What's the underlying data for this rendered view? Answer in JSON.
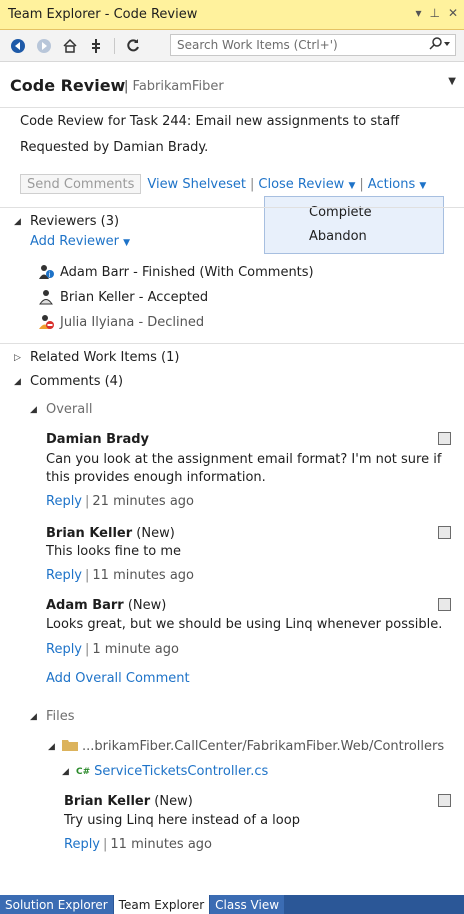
{
  "window": {
    "title": "Team Explorer - Code Review"
  },
  "toolbar": {
    "search_placeholder": "Search Work Items (Ctrl+')"
  },
  "header": {
    "title": "Code Review",
    "project": "FabrikamFiber"
  },
  "review": {
    "title_line": "Code Review for Task 244: Email new assignments to staff",
    "requested_line": "Requested by Damian Brady."
  },
  "actions": {
    "send_comments": "Send Comments",
    "view_shelveset": "View Shelveset",
    "close_review": "Close Review",
    "actions": "Actions"
  },
  "close_menu": {
    "complete": "Complete",
    "abandon": "Abandon"
  },
  "reviewers": {
    "header": "Reviewers (3)",
    "add": "Add Reviewer",
    "items": [
      {
        "text": "Adam Barr - Finished (With Comments)",
        "icon": "reviewer-finished-icon"
      },
      {
        "text": "Brian Keller - Accepted",
        "icon": "reviewer-accepted-icon"
      },
      {
        "text": "Julia Ilyiana - Declined",
        "icon": "reviewer-declined-icon"
      }
    ]
  },
  "related": {
    "header": "Related Work Items (1)"
  },
  "comments": {
    "header": "Comments (4)",
    "overall_label": "Overall",
    "add_overall": "Add Overall Comment",
    "overall": [
      {
        "author": "Damian Brady",
        "status": "",
        "text1": "Can you look at the assignment email format? I'm not sure if",
        "text2": "this provides enough information.",
        "reply": "Reply",
        "time": "21 minutes ago"
      },
      {
        "author": "Brian Keller",
        "status": "(New)",
        "text1": "This looks fine to me",
        "text2": "",
        "reply": "Reply",
        "time": "11 minutes ago"
      },
      {
        "author": "Adam Barr",
        "status": "(New)",
        "text1": "Looks great, but we should be using Linq whenever possible.",
        "text2": "",
        "reply": "Reply",
        "time": "1 minute ago"
      }
    ],
    "files_label": "Files",
    "folder": "...brikamFiber.CallCenter/FabrikamFiber.Web/Controllers",
    "file_badge": "C#",
    "file": "ServiceTicketsController.cs",
    "file_comment": {
      "author": "Brian Keller",
      "status": "(New)",
      "text": "Try using Linq here instead of a loop",
      "reply": "Reply",
      "time": "11 minutes ago"
    }
  },
  "bottom_tabs": [
    "Solution Explorer",
    "Team Explorer",
    "Class View"
  ],
  "colors": {
    "title_bar": "#fff29d",
    "link": "#1e73c8",
    "tab_strip": "#2b5797",
    "menu_bg": "#e8f0fb"
  }
}
